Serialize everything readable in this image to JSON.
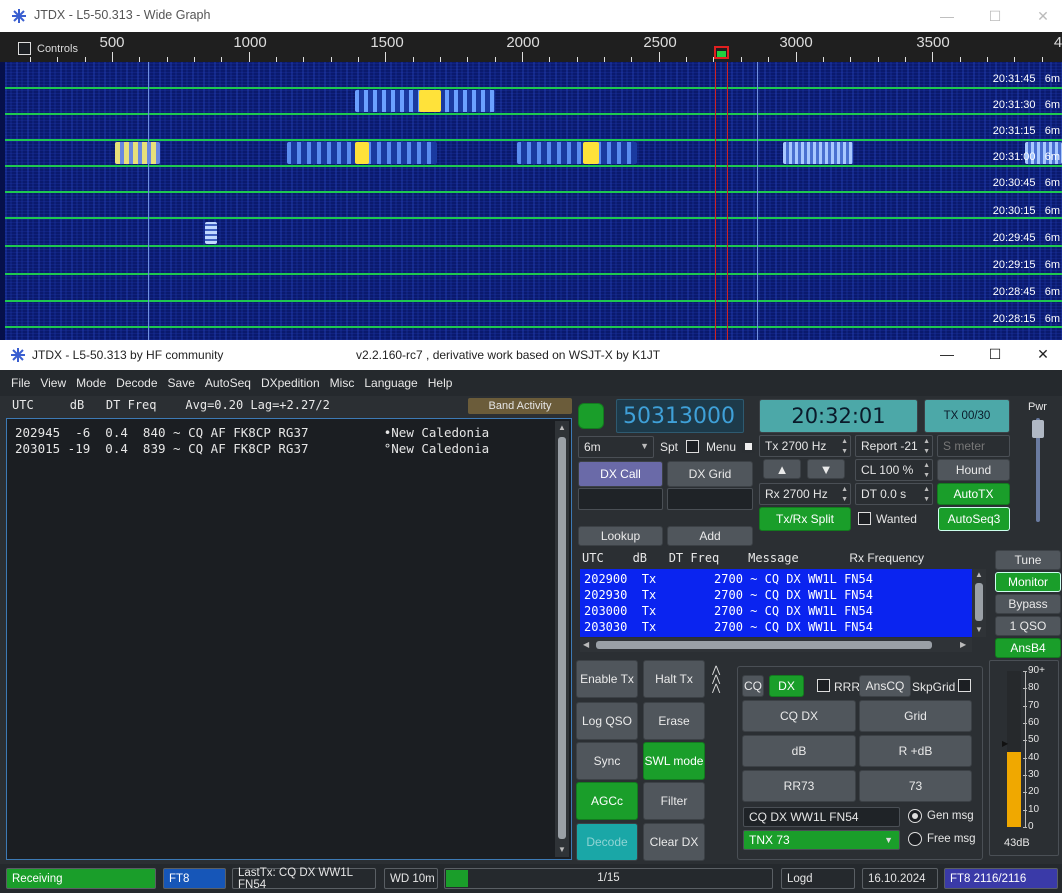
{
  "wide_graph": {
    "title": "JTDX - L5-50.313 - Wide Graph",
    "controls_label": "Controls",
    "freq_ticks": [
      "500",
      "1000",
      "1500",
      "2000",
      "2500",
      "3000",
      "3500",
      "4"
    ],
    "timestamps": [
      {
        "time": "20:31:45",
        "band": "6m"
      },
      {
        "time": "20:31:30",
        "band": "6m"
      },
      {
        "time": "20:31:15",
        "band": "6m"
      },
      {
        "time": "20:31:00",
        "band": "6m"
      },
      {
        "time": "20:30:45",
        "band": "6m"
      },
      {
        "time": "20:30:15",
        "band": "6m"
      },
      {
        "time": "20:29:45",
        "band": "6m"
      },
      {
        "time": "20:29:15",
        "band": "6m"
      },
      {
        "time": "20:28:45",
        "band": "6m"
      },
      {
        "time": "20:28:15",
        "band": "6m"
      }
    ]
  },
  "main": {
    "title": "JTDX - L5-50.313  by HF community",
    "version": "v2.2.160-rc7 , derivative work based on WSJT-X by K1JT",
    "menu": [
      "File",
      "View",
      "Mode",
      "Decode",
      "Save",
      "AutoSeq",
      "DXpedition",
      "Misc",
      "Language",
      "Help"
    ],
    "band_activity": {
      "header": "UTC     dB   DT Freq    Avg=0.20 Lag=+2.27/2",
      "button": "Band Activity",
      "rows": [
        "202945  -6  0.4  840 ~ CQ AF FK8CP RG37          •New Caledonia",
        "203015 -19  0.4  839 ~ CQ AF FK8CP RG37          °New Caledonia"
      ]
    },
    "frequency": "50313000",
    "clock": "20:32:01",
    "tx_counter": "TX 00/30",
    "pwr_label": "Pwr",
    "band": "6m",
    "spt_label": "Spt",
    "menu_label": "Menu",
    "tx_freq": "Tx  2700  Hz",
    "rx_freq": "Rx  2700  Hz",
    "report": "Report -21",
    "s_meter_placeholder": "S meter",
    "cl": "CL  100 %",
    "dt": "DT 0.0 s",
    "dx_call_btn": "DX Call",
    "dx_grid_btn": "DX Grid",
    "up_arrow": "▲",
    "down_arrow": "▼",
    "hound_btn": "Hound",
    "autotx_btn": "AutoTX",
    "autoseq_btn": "AutoSeq3",
    "txrx_split_btn": "Tx/Rx Split",
    "wanted_label": "Wanted",
    "lookup_btn": "Lookup",
    "add_btn": "Add",
    "rx_header": "UTC    dB   DT Freq    Message",
    "rx_freq_header": "Rx Frequency",
    "rx_rows": [
      "202900  Tx        2700 ~ CQ DX WW1L FN54",
      "202930  Tx        2700 ~ CQ DX WW1L FN54",
      "203000  Tx        2700 ~ CQ DX WW1L FN54",
      "203030  Tx        2700 ~ CQ DX WW1L FN54"
    ],
    "side_buttons": [
      "Tune",
      "Monitor",
      "Bypass",
      "1 QSO",
      "AnsB4"
    ],
    "left_buttons": {
      "enable_tx": "Enable Tx",
      "halt_tx": "Halt Tx",
      "log_qso": "Log QSO",
      "erase": "Erase",
      "sync": "Sync",
      "swl_mode": "SWL mode",
      "agcc": "AGCc",
      "filter": "Filter",
      "decode": "Decode",
      "clear_dx": "Clear DX"
    },
    "msg_panel": {
      "cq": "CQ",
      "dx": "DX",
      "rrr": "RRR",
      "anscq": "AnsCQ",
      "skpgrid": "SkpGrid",
      "buttons": [
        "CQ DX",
        "Grid",
        "dB",
        "R +dB",
        "RR73",
        "73"
      ],
      "gen_msg_value": "CQ DX WW1L FN54",
      "gen_msg_label": "Gen msg",
      "free_msg_value": "TNX 73",
      "free_msg_label": "Free msg"
    },
    "meter": {
      "ticks": [
        "90+",
        "80",
        "70",
        "60",
        "50",
        "40",
        "30",
        "20",
        "10",
        "0"
      ],
      "value_label": "43dB",
      "level_db": 43
    },
    "status": {
      "state": "Receiving",
      "mode": "FT8",
      "last_tx": "LastTx: CQ DX WW1L FN54",
      "wd": "WD 10m",
      "progress": "1/15",
      "progress_fraction": 0.067,
      "logd": "Logd",
      "date": "16.10.2024",
      "decode_count": "FT8  2116/2116"
    }
  }
}
